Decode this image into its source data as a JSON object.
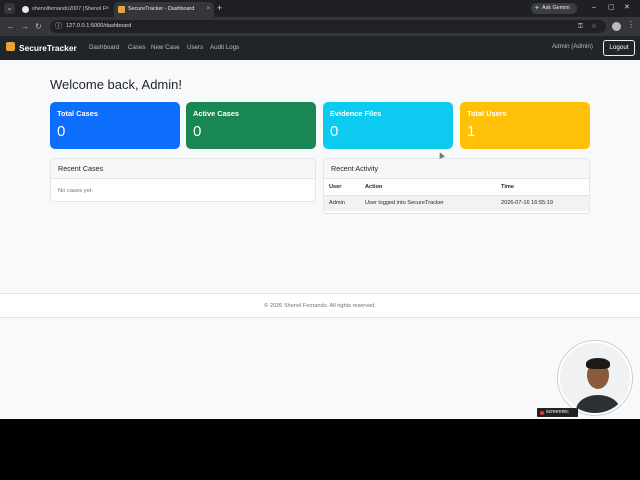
{
  "browser": {
    "tabs": [
      {
        "title": "shenolfernando2007 (Shenol F",
        "active": false
      },
      {
        "title": "SecureTracker - Dashboard",
        "active": true
      }
    ],
    "new_tab_glyph": "+",
    "gemini_label": "Ask Gemini",
    "url": "127.0.0.1:5000/dashboard"
  },
  "app": {
    "brand": "SecureTracker",
    "nav": [
      "Dashboard",
      "Cases",
      "New Case",
      "Users",
      "Audit Logs"
    ],
    "user": "Admin (Admin)",
    "logout_label": "Logout"
  },
  "page": {
    "welcome": "Welcome back, Admin!",
    "stats": [
      {
        "title": "Total Cases",
        "value": "0",
        "color": "#0d6efd"
      },
      {
        "title": "Active Cases",
        "value": "0",
        "color": "#198754"
      },
      {
        "title": "Evidence Files",
        "value": "0",
        "color": "#0dcaf0"
      },
      {
        "title": "Total Users",
        "value": "1",
        "color": "#ffc107"
      }
    ],
    "recent_cases": {
      "title": "Recent Cases",
      "empty_text": "No cases yet."
    },
    "recent_activity": {
      "title": "Recent Activity",
      "columns": [
        "User",
        "Action",
        "Time"
      ],
      "rows": [
        {
          "user": "Admin",
          "action": "User logged into SecureTracker",
          "time": "2026-07-16 16:55:19"
        }
      ]
    },
    "footer": "© 2026 Shenol Fernando. All rights reserved."
  },
  "overlay": {
    "recorder_label": "screenrec"
  }
}
